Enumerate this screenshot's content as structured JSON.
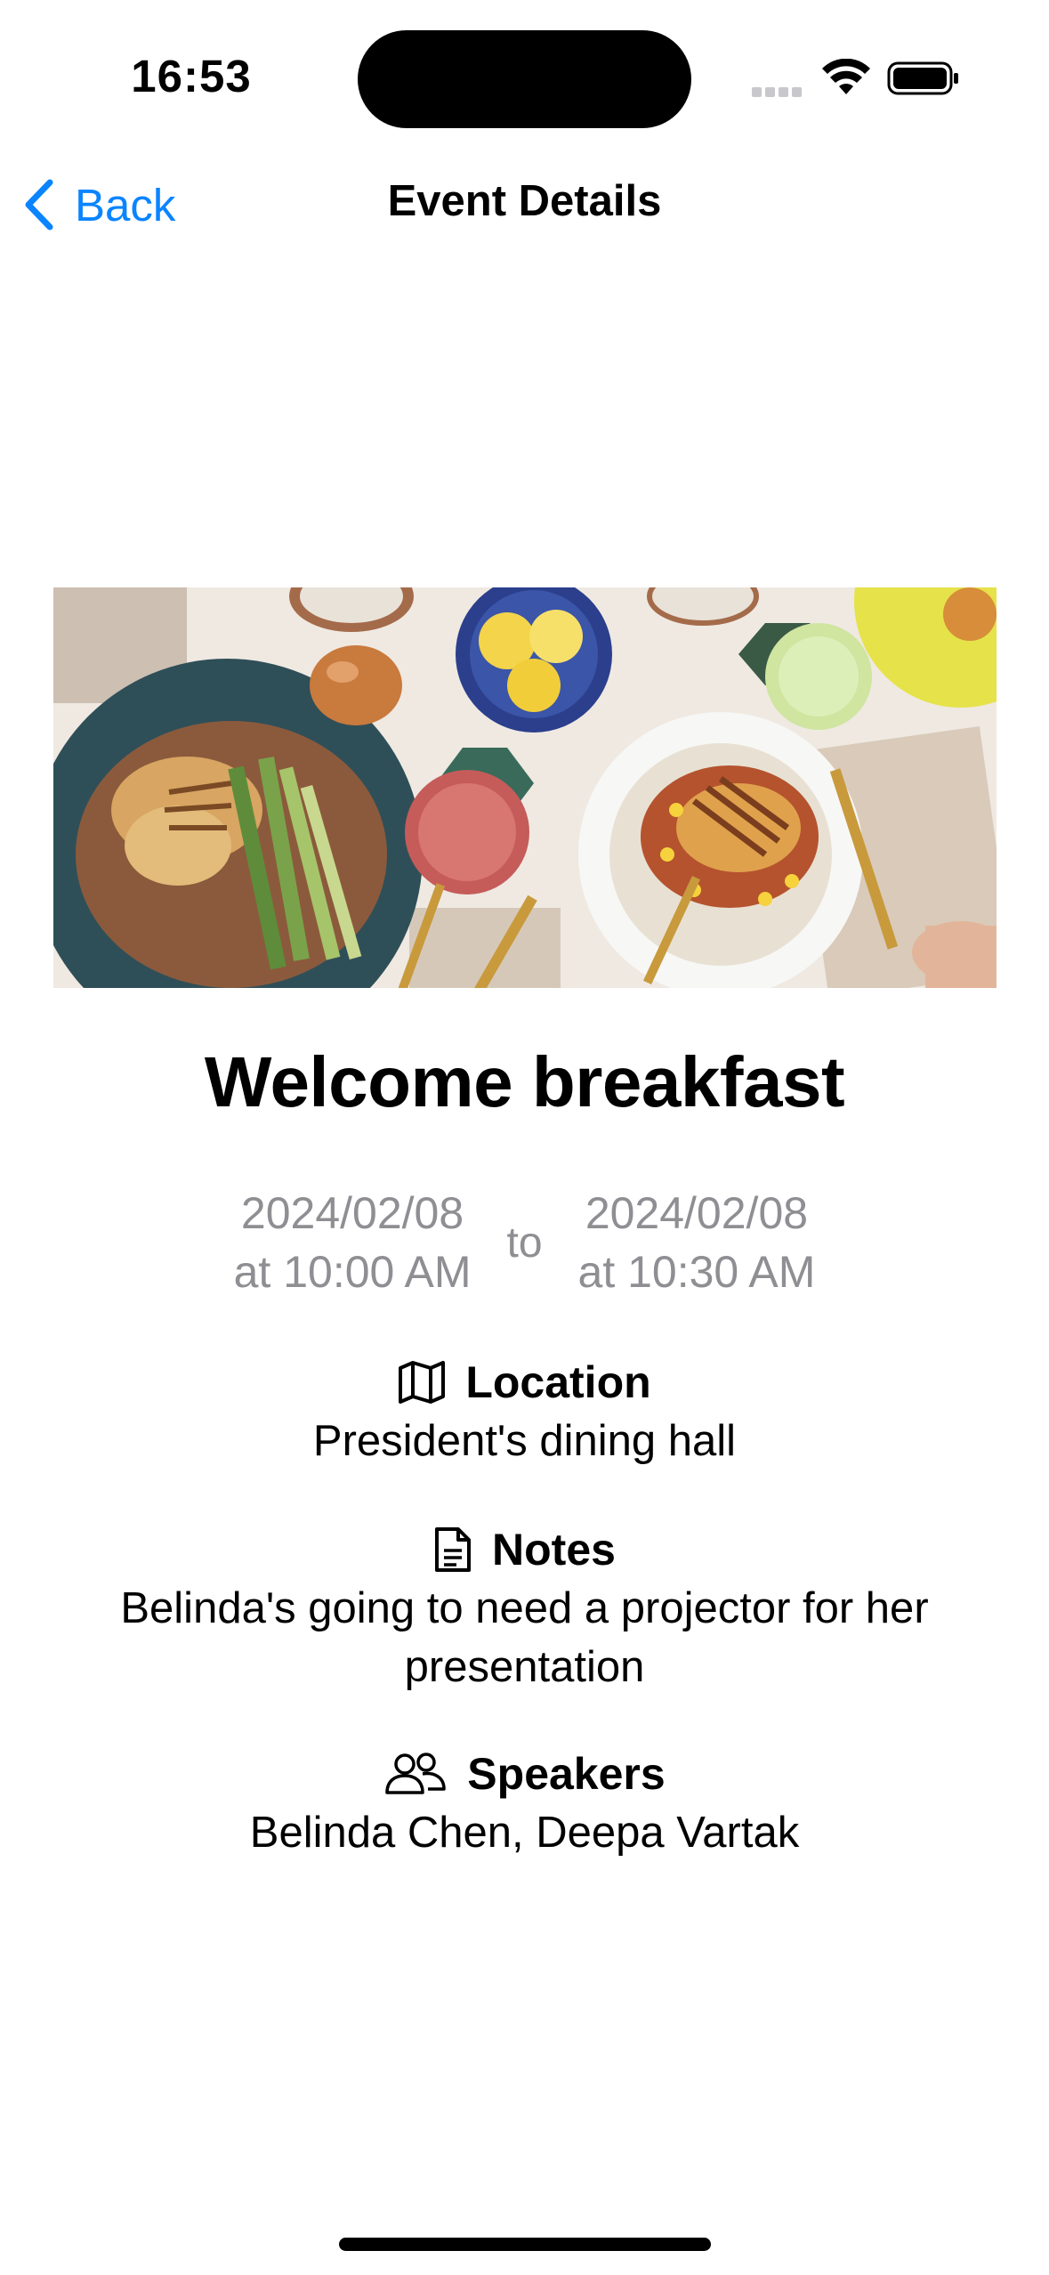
{
  "status_bar": {
    "time": "16:53"
  },
  "nav": {
    "back_label": "Back",
    "title": "Event Details"
  },
  "event": {
    "title": "Welcome breakfast",
    "start_date": "2024/02/08",
    "start_time": "at 10:00 AM",
    "to_label": "to",
    "end_date": "2024/02/08",
    "end_time": "at 10:30 AM"
  },
  "sections": {
    "location": {
      "icon": "map-icon",
      "label": "Location",
      "value": "President's dining hall"
    },
    "notes": {
      "icon": "document-icon",
      "label": "Notes",
      "value": "Belinda's going to need a projector for her presentation"
    },
    "speakers": {
      "icon": "people-icon",
      "label": "Speakers",
      "value": "Belinda Chen, Deepa Vartak"
    }
  },
  "colors": {
    "accent": "#0a84ff",
    "secondary_text": "#8e8e93"
  }
}
